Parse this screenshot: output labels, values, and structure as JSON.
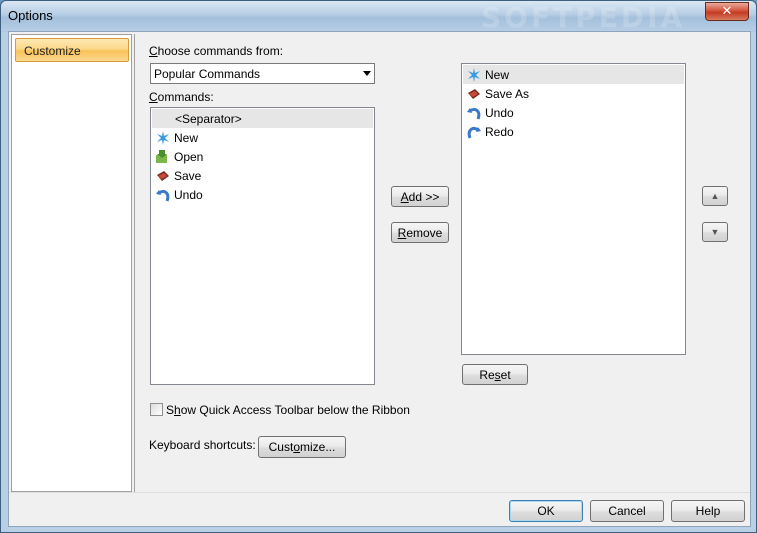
{
  "window": {
    "title": "Options",
    "close_label": "✕",
    "watermark": "SOFTPEDIA"
  },
  "nav": {
    "items": [
      {
        "label": "Customize",
        "selected": true
      }
    ]
  },
  "commands": {
    "choose_label": "Choose commands from:",
    "choose_value": "Popular Commands",
    "list_label": "Commands:",
    "items": [
      {
        "label": "<Separator>",
        "icon": "none",
        "selected": true
      },
      {
        "label": "New",
        "icon": "new-icon"
      },
      {
        "label": "Open",
        "icon": "open-icon"
      },
      {
        "label": "Save",
        "icon": "save-icon"
      },
      {
        "label": "Undo",
        "icon": "undo-icon"
      }
    ]
  },
  "toolbar_items": {
    "items": [
      {
        "label": "New",
        "icon": "new-icon",
        "selected": true
      },
      {
        "label": "Save As",
        "icon": "save-as-icon"
      },
      {
        "label": "Undo",
        "icon": "undo-icon"
      },
      {
        "label": "Redo",
        "icon": "redo-icon"
      }
    ]
  },
  "buttons": {
    "add": "Add >>",
    "remove": "Remove",
    "reset": "Reset",
    "move_up": "▲",
    "move_down": "▼",
    "customize": "Customize...",
    "ok": "OK",
    "cancel": "Cancel",
    "help": "Help"
  },
  "options": {
    "show_below_ribbon_label": "Show Quick Access Toolbar below the Ribbon",
    "show_below_ribbon_checked": false,
    "keyboard_label": "Keyboard shortcuts:"
  },
  "colors": {
    "accent": "#f9c25a",
    "selection": "#e6e6e6",
    "icon_blue": "#3a78c9"
  }
}
